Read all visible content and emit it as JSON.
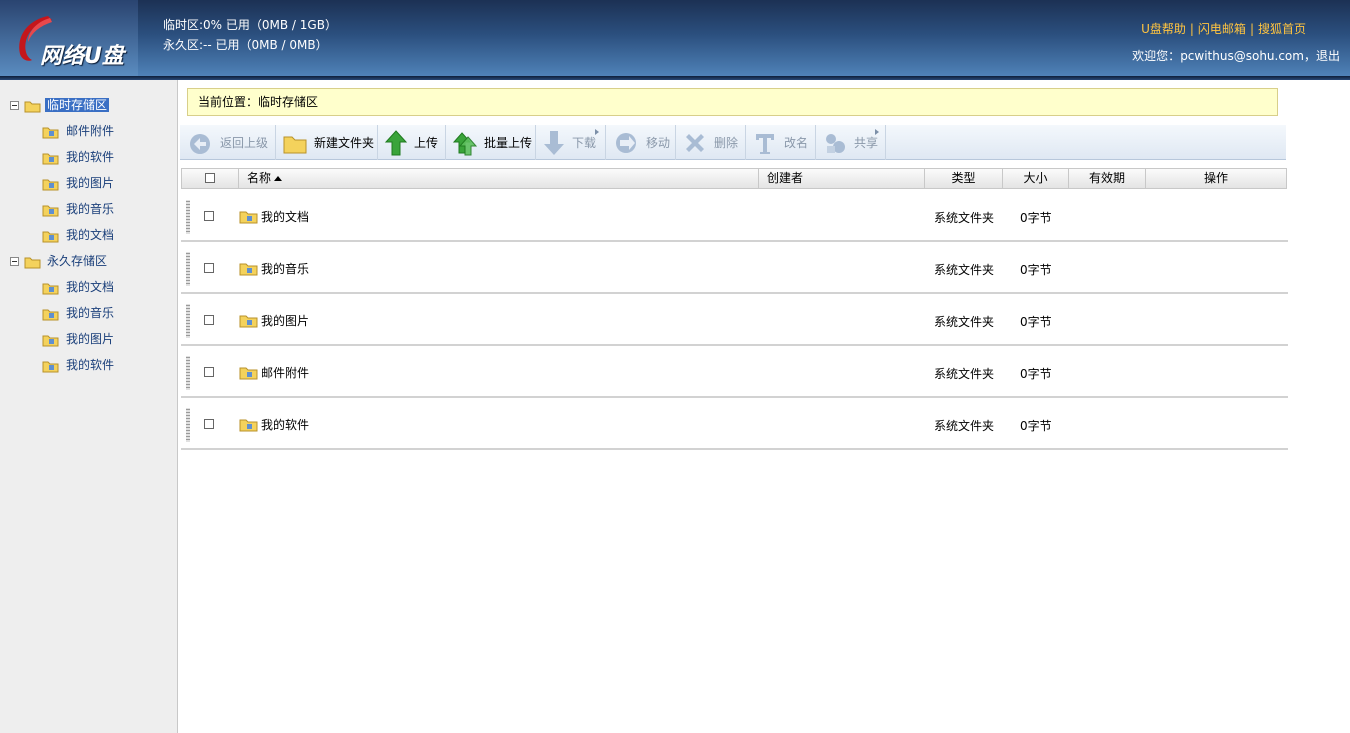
{
  "header": {
    "logo_text": "网络U盘",
    "quota_temp": "临时区:0% 已用（0MB / 1GB）",
    "quota_perm": "永久区:-- 已用（0MB / 0MB）",
    "links": [
      "U盘帮助",
      "闪电邮箱",
      "搜狐首页"
    ],
    "welcome_prefix": "欢迎您：",
    "user_email": "pcwithus@sohu.com",
    "logout": "退出",
    "welcome_sep": "，"
  },
  "sidebar": {
    "groups": [
      {
        "label": "临时存储区",
        "selected": true,
        "items": [
          "邮件附件",
          "我的软件",
          "我的图片",
          "我的音乐",
          "我的文档"
        ]
      },
      {
        "label": "永久存储区",
        "selected": false,
        "items": [
          "我的文档",
          "我的音乐",
          "我的图片",
          "我的软件"
        ]
      }
    ]
  },
  "breadcrumb": {
    "prefix": "当前位置：",
    "location": "临时存储区"
  },
  "toolbar": {
    "back": "返回上级",
    "new_folder": "新建文件夹",
    "upload": "上传",
    "batch_upload": "批量上传",
    "download": "下载",
    "move": "移动",
    "delete": "删除",
    "rename": "改名",
    "share": "共享"
  },
  "table": {
    "headers": {
      "name": "名称",
      "creator": "创建者",
      "type": "类型",
      "size": "大小",
      "expiry": "有效期",
      "action": "操作"
    },
    "rows": [
      {
        "name": "我的文档",
        "type": "系统文件夹",
        "size": "0字节"
      },
      {
        "name": "我的音乐",
        "type": "系统文件夹",
        "size": "0字节"
      },
      {
        "name": "我的图片",
        "type": "系统文件夹",
        "size": "0字节"
      },
      {
        "name": "邮件附件",
        "type": "系统文件夹",
        "size": "0字节"
      },
      {
        "name": "我的软件",
        "type": "系统文件夹",
        "size": "0字节"
      }
    ]
  },
  "colors": {
    "header_top": "#1c3154",
    "header_bottom": "#4f82b8",
    "link": "#ffc440",
    "tree_text": "#1a3f7a",
    "selected": "#3a6fc4",
    "crumb_bg": "#ffffcc"
  }
}
